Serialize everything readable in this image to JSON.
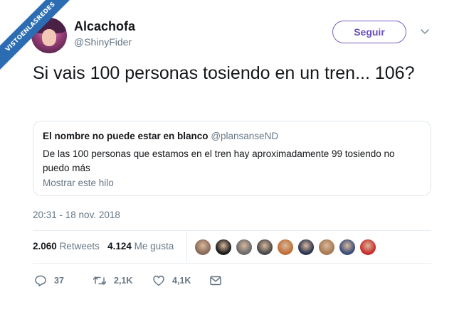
{
  "watermark": "VISTOENLASREDES",
  "author": {
    "name": "Alcachofa",
    "handle": "@ShinyFider"
  },
  "follow_label": "Seguir",
  "tweet_text": "Si vais 100 personas tosiendo en un tren... 106?",
  "quoted": {
    "author_name": "El nombre no puede estar en blanco",
    "author_handle": "@plansanseND",
    "text": "De las 100 personas que estamos en el tren hay aproximadamente 99 tosiendo no puedo más",
    "show_thread": "Mostrar este hilo"
  },
  "timestamp": "20:31 - 18 nov. 2018",
  "stats": {
    "retweets_count": "2.060",
    "retweets_label": "Retweets",
    "likes_count": "4.124",
    "likes_label": "Me gusta"
  },
  "likers": [
    {
      "color": "#8a6a5a"
    },
    {
      "color": "#1c1c1c"
    },
    {
      "color": "#6b6b6b"
    },
    {
      "color": "#4a4a4a"
    },
    {
      "color": "#c0703a"
    },
    {
      "color": "#2d3550"
    },
    {
      "color": "#a77a52"
    },
    {
      "color": "#3c4f7a"
    },
    {
      "color": "#c8302c"
    }
  ],
  "actions": {
    "reply_count": "37",
    "retweet_count": "2,1K",
    "like_count": "4,1K"
  },
  "icons": {
    "reply": "reply-icon",
    "retweet": "retweet-icon",
    "like": "heart-icon",
    "dm": "envelope-icon",
    "more": "chevron-down-icon"
  },
  "colors": {
    "accent": "#7c5ec2",
    "muted": "#657786",
    "text": "#14171a",
    "border": "#e1e8ed",
    "watermark": "#2b6cb3"
  }
}
